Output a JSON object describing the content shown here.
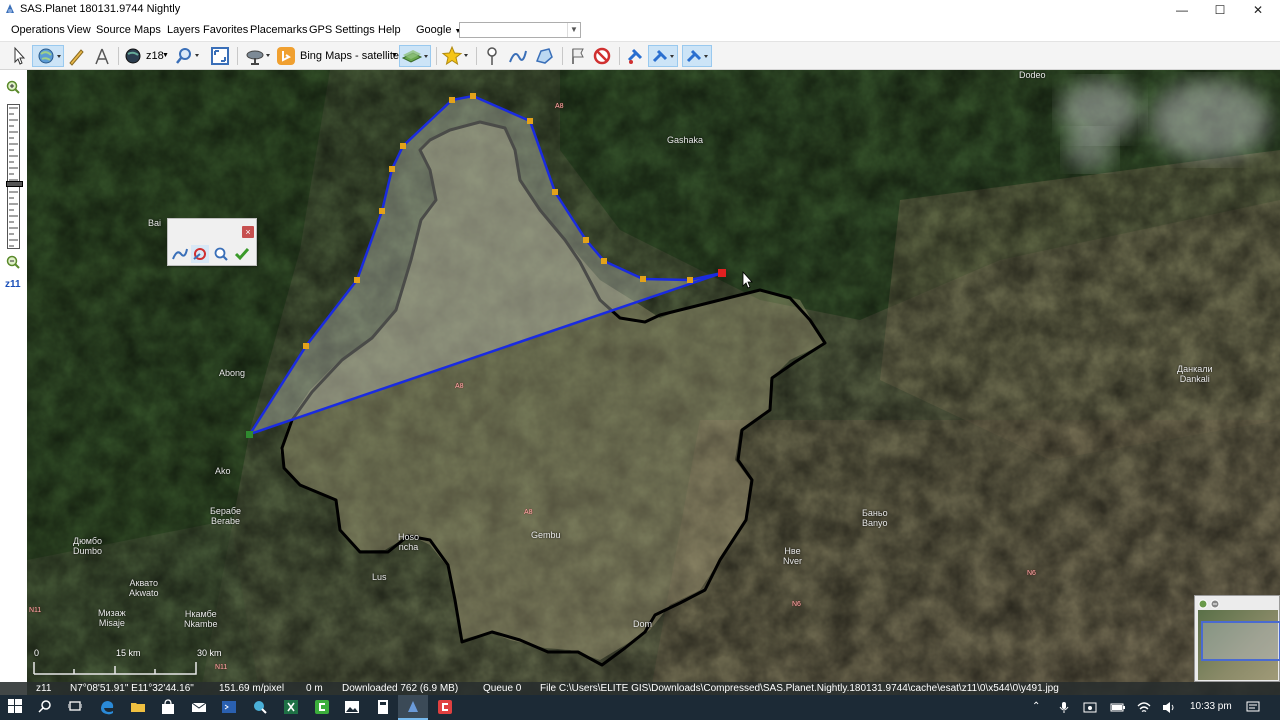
{
  "window": {
    "title": "SAS.Planet 180131.9744 Nightly",
    "min": "—",
    "max": "☐",
    "close": "✕"
  },
  "menu": [
    "Operations",
    "View",
    "Source",
    "Maps",
    "Layers",
    "Favorites",
    "Placemarks",
    "GPS",
    "Settings",
    "Help"
  ],
  "geocoder": {
    "label": "Google",
    "value": ""
  },
  "toolbar": {
    "zoom_label": "z18",
    "map_source": "Bing Maps - satellite"
  },
  "sidebar": {
    "zoom_label": "z11"
  },
  "map_labels": [
    {
      "text": "Dodeo"
    },
    {
      "text": "Gashaka"
    },
    {
      "text": "Bai"
    },
    {
      "text": "Abong"
    },
    {
      "text": "Ako"
    },
    {
      "text": "Берабе\nBerabe"
    },
    {
      "text": "Дюмбо\nDumbo"
    },
    {
      "text": "Аквато\nAkwato"
    },
    {
      "text": "Мизаж\nMisaje"
    },
    {
      "text": "Нкамбе\nNkambe"
    },
    {
      "text": "Lus"
    },
    {
      "text": "Gembu"
    },
    {
      "text": "Dom"
    },
    {
      "text": "Нве\nNver"
    },
    {
      "text": "Баньо\nBanyo"
    },
    {
      "text": "Данкали\nDankali"
    },
    {
      "text": "Hoso\nncha"
    }
  ],
  "road_labels": [
    "A8",
    "A8",
    "A8",
    "N6",
    "N6",
    "N11",
    "N11"
  ],
  "scale": {
    "zero": "0",
    "mid": "15 km",
    "end": "30 km"
  },
  "status": {
    "zoom": "z11",
    "coords": "N7°08'51.91\" E11°32'44.16\"",
    "resolution": "151.69 m/pixel",
    "altitude": "0 m",
    "downloaded": "Downloaded 762 (6.9 MB)",
    "queue": "Queue 0",
    "file": "File C:\\Users\\ELITE GIS\\Downloads\\Compressed\\SAS.Planet.Nightly.180131.9744\\cache\\esat\\z11\\0\\x544\\0\\y491.jpg"
  },
  "taskbar": {
    "time": "10:33 pm"
  },
  "colors": {
    "polygon_line": "#1a2be0",
    "vertex": "#e3a21a",
    "boundary": "#000000",
    "taskbar": "#1c2a36"
  }
}
